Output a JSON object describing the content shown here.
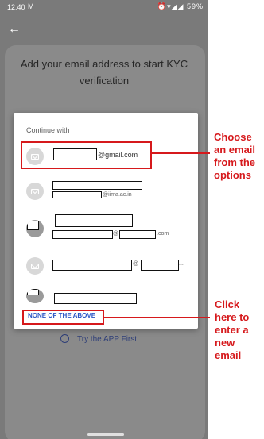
{
  "status": {
    "time": "12:40",
    "mail_icon": "gmail-icon",
    "right_icons": "⏰▾◢◢",
    "battery": "59%"
  },
  "page": {
    "heading_line1": "Add your email address to start KYC",
    "heading_line2": "verification",
    "try_app": "Try the APP First"
  },
  "dialog": {
    "title": "Continue with",
    "accounts": [
      {
        "suffix": "@gmail.com"
      },
      {
        "suffix": "@iima.ac.in"
      },
      {
        "at": "@",
        "suffix": ".com"
      },
      {
        "at": "@",
        "suffix": "..."
      },
      {}
    ],
    "none_label": "NONE OF THE ABOVE"
  },
  "annotations": {
    "choose": [
      "Choose",
      "an email",
      "from the",
      "options"
    ],
    "click": [
      "Click",
      "here to",
      "enter a",
      "new",
      "email"
    ]
  },
  "colors": {
    "annotation": "#d6191c",
    "link": "#2a56c6"
  }
}
